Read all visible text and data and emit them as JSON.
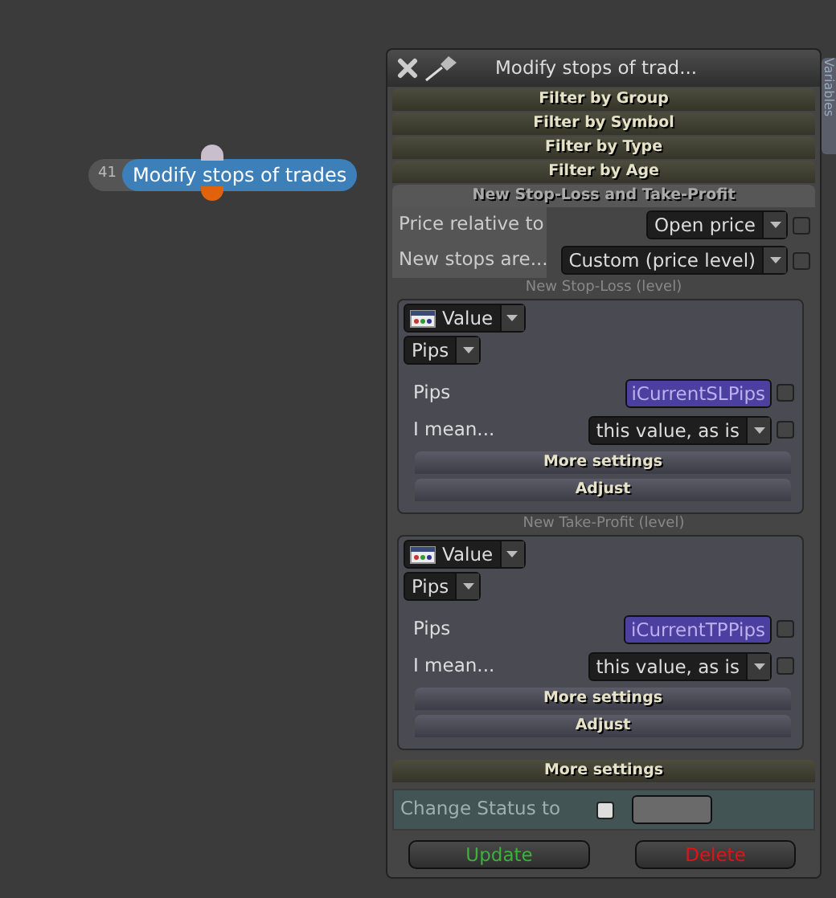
{
  "node": {
    "number": "41",
    "title": "Modify stops of trades"
  },
  "panel": {
    "title": "Modify stops of trad...",
    "side_tab": "Variables",
    "sections": [
      {
        "label": "Filter by Group",
        "expanded": false
      },
      {
        "label": "Filter by Symbol",
        "expanded": false
      },
      {
        "label": "Filter by Type",
        "expanded": false
      },
      {
        "label": "Filter by Age",
        "expanded": false
      },
      {
        "label": "New Stop-Loss and Take-Profit",
        "expanded": true
      }
    ],
    "fields": [
      {
        "label": "Price relative to",
        "value": "Open price",
        "checked": false
      },
      {
        "label": "New stops are...",
        "value": "Custom (price level)",
        "checked": false
      }
    ],
    "groups": [
      {
        "caption": "New Stop-Loss (level)",
        "source": "Value",
        "unit": "Pips",
        "rows": [
          {
            "kind": "variable",
            "label": "Pips",
            "value": "iCurrentSLPips",
            "checked": false
          },
          {
            "kind": "select",
            "label": "I mean...",
            "value": "this value, as is",
            "checked": false
          }
        ],
        "buttons": [
          "More settings",
          "Adjust"
        ]
      },
      {
        "caption": "New Take-Profit (level)",
        "source": "Value",
        "unit": "Pips",
        "rows": [
          {
            "kind": "variable",
            "label": "Pips",
            "value": "iCurrentTPPips",
            "checked": false
          },
          {
            "kind": "select",
            "label": "I mean...",
            "value": "this value, as is",
            "checked": false
          }
        ],
        "buttons": [
          "More settings",
          "Adjust"
        ]
      }
    ],
    "more_settings": "More settings",
    "status": {
      "label": "Change Status to",
      "checked": false
    },
    "buttons": [
      {
        "label": "Update",
        "kind": "update"
      },
      {
        "label": "Delete",
        "kind": "delete"
      }
    ]
  }
}
